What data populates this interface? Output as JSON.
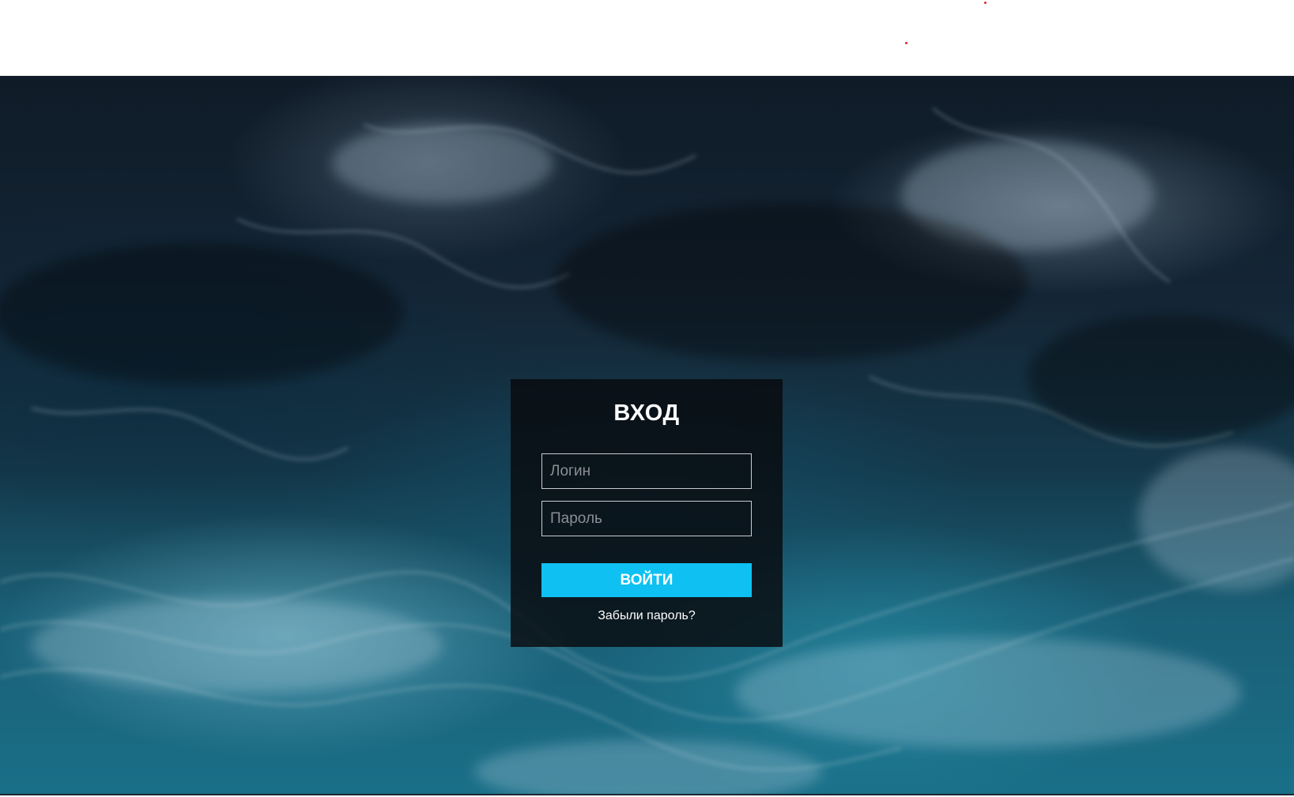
{
  "login": {
    "title": "ВХОД",
    "username_placeholder": "Логин",
    "password_placeholder": "Пароль",
    "submit_label": "ВОЙТИ",
    "forgot_label": "Забыли пароль?"
  },
  "colors": {
    "accent": "#0ec1f2",
    "panel": "#080a0e",
    "background_ocean": "#14394b",
    "marker_dots": "#e0262b"
  }
}
